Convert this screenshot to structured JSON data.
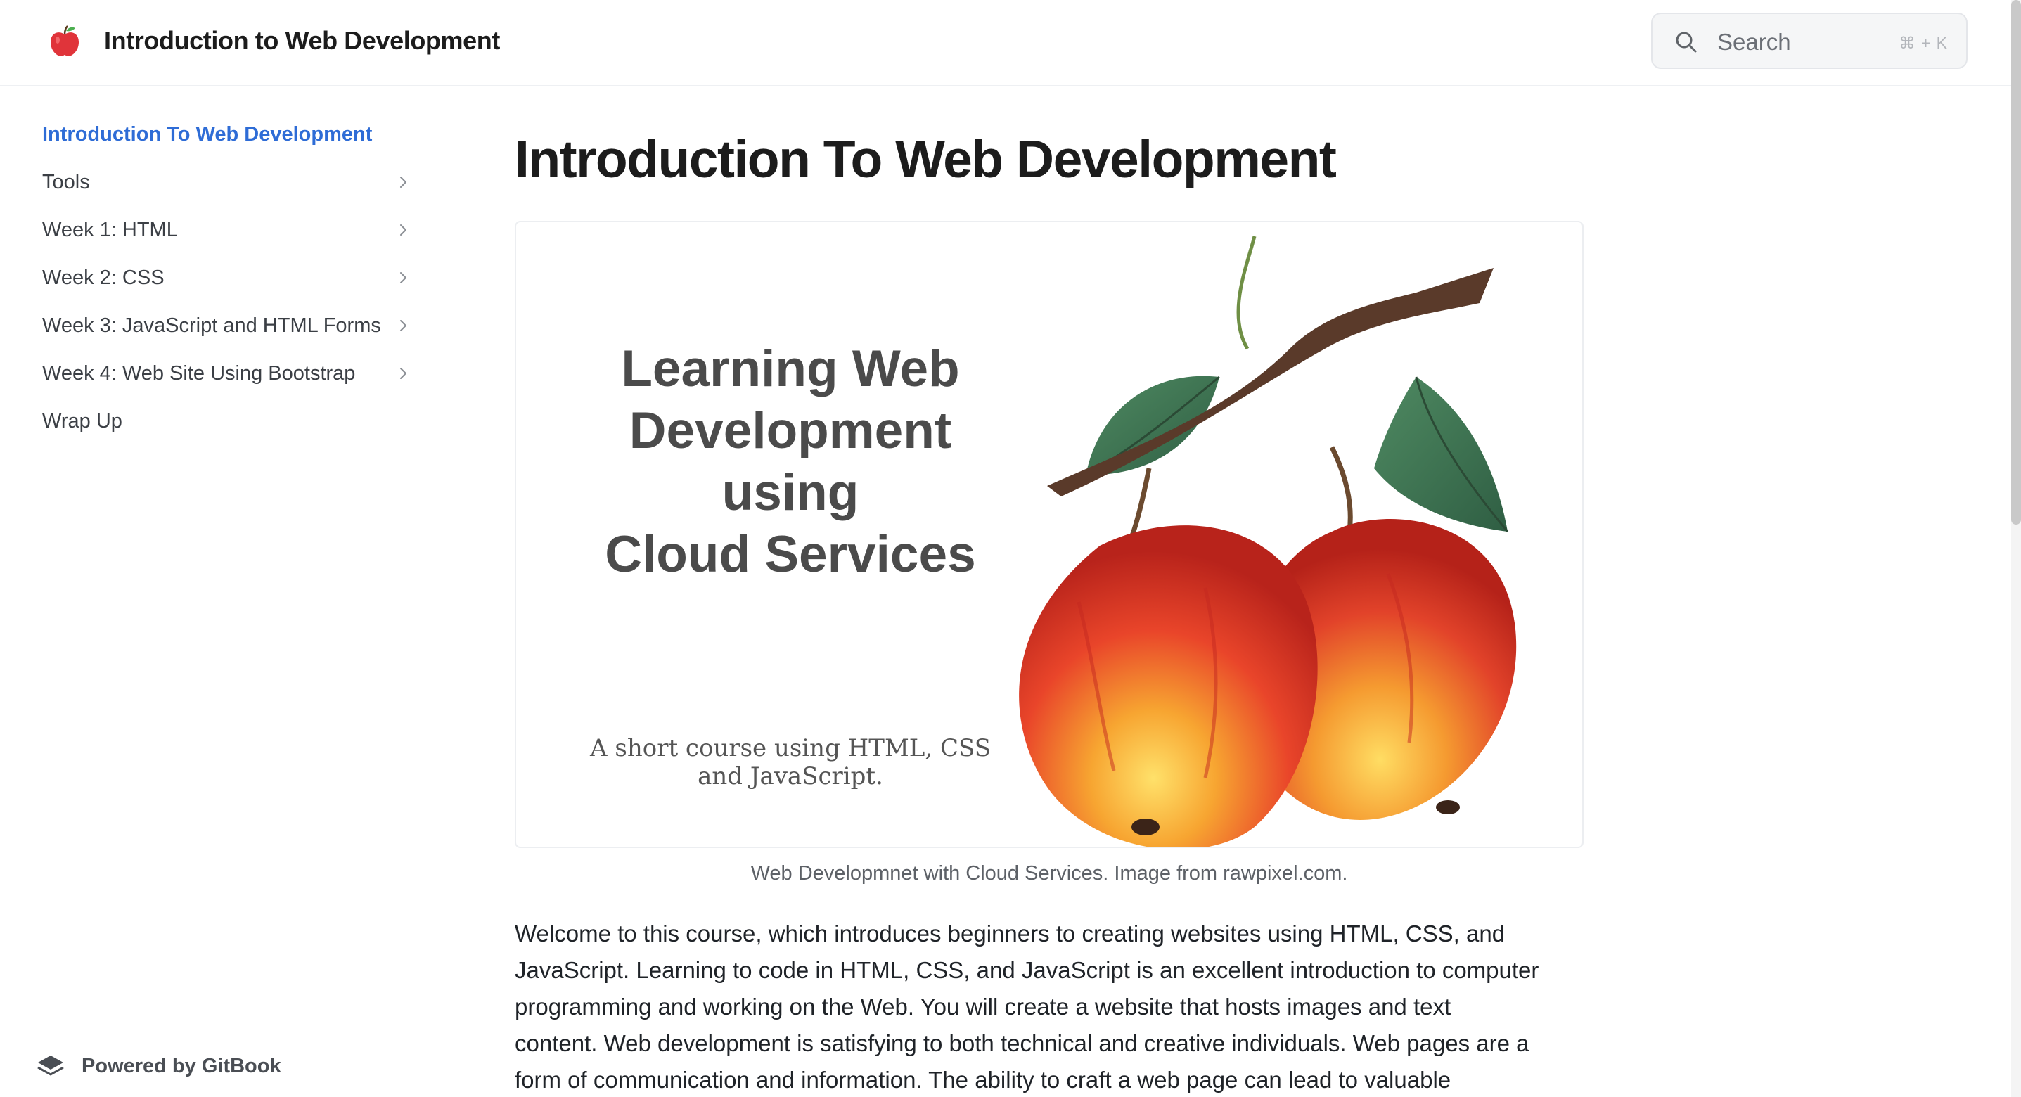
{
  "header": {
    "site_title": "Introduction to Web Development",
    "logo_icon": "apple-icon",
    "search": {
      "placeholder": "Search",
      "shortcut": "⌘ + K"
    }
  },
  "sidebar": {
    "items": [
      {
        "label": "Introduction To Web Development",
        "active": true,
        "expandable": false
      },
      {
        "label": "Tools",
        "active": false,
        "expandable": true
      },
      {
        "label": "Week 1: HTML",
        "active": false,
        "expandable": true
      },
      {
        "label": "Week 2: CSS",
        "active": false,
        "expandable": true
      },
      {
        "label": "Week 3: JavaScript and HTML Forms",
        "active": false,
        "expandable": true
      },
      {
        "label": "Week 4: Web Site Using Bootstrap",
        "active": false,
        "expandable": true
      },
      {
        "label": "Wrap Up",
        "active": false,
        "expandable": false
      }
    ],
    "powered_by": "Powered by GitBook"
  },
  "main": {
    "title": "Introduction To Web Development",
    "figure": {
      "heading_lines": [
        "Learning Web",
        "Development",
        "using",
        "Cloud Services"
      ],
      "subtitle_lines": [
        "A short course using HTML, CSS",
        "and JavaScript."
      ],
      "caption": "Web Developmnet with Cloud Services. Image from rawpixel.com."
    },
    "body_lines": [
      "Welcome to this course, which introduces beginners to creating websites using HTML, CSS, and",
      "JavaScript.   Learning to code in HTML, CSS, and JavaScript is an excellent introduction to computer",
      "programming and working on the Web.  You will create a website that hosts images and text",
      "content.  Web development is satisfying to both technical and creative individuals.  Web pages are a",
      "form of communication and information. The ability to craft a web page can lead to valuable"
    ]
  },
  "colors": {
    "accent": "#2e6cd6",
    "text": "#1f2328",
    "muted": "#5d6167"
  }
}
